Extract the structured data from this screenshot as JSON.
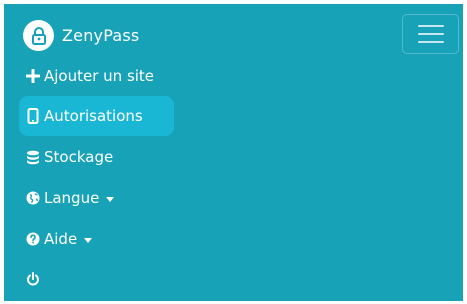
{
  "brand": {
    "name": "ZenyPass",
    "logo_icon": "lock-logo-icon"
  },
  "toggler": {
    "icon": "hamburger-menu-icon"
  },
  "nav": {
    "items": [
      {
        "label": "Ajouter un site",
        "icon": "plus-icon"
      },
      {
        "label": "Autorisations",
        "icon": "mobile-icon",
        "active": true
      },
      {
        "label": "Stockage",
        "icon": "database-icon"
      },
      {
        "label": "Langue",
        "icon": "globe-icon",
        "dropdown": true
      },
      {
        "label": "Aide",
        "icon": "question-circle-icon",
        "dropdown": true
      },
      {
        "label": "",
        "icon": "power-icon"
      }
    ]
  },
  "colors": {
    "background": "#17a2b8",
    "active": "#1ab7d5",
    "text": "#ffffff"
  }
}
